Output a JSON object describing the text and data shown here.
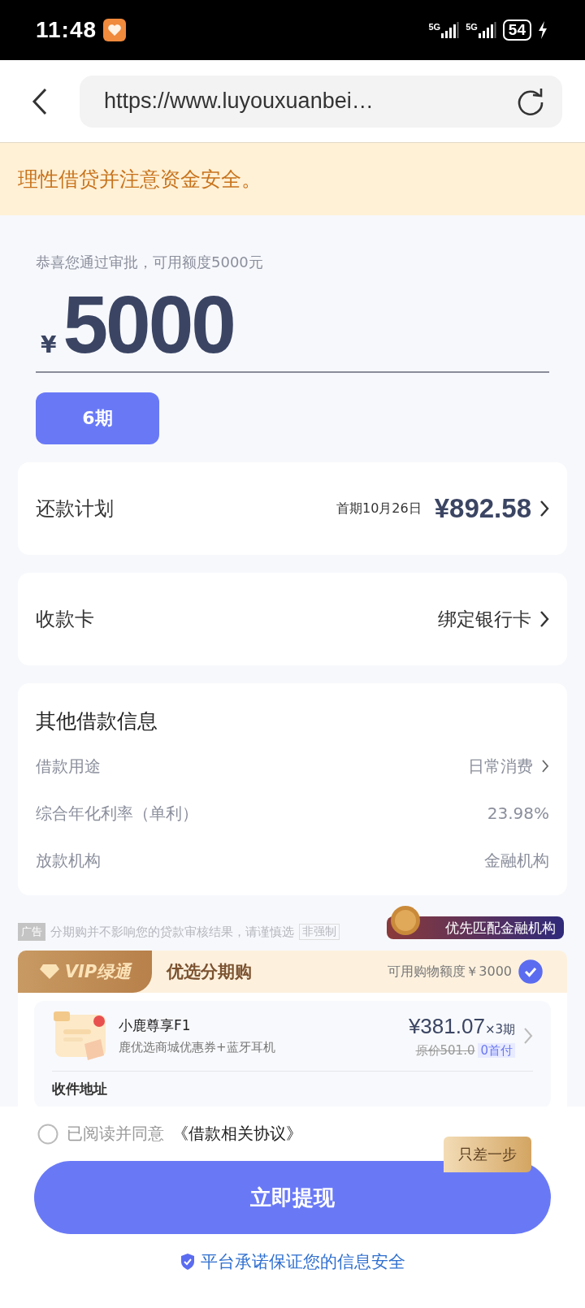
{
  "status_bar": {
    "time": "11:48",
    "networks": [
      "5G",
      "5G"
    ],
    "battery": "54"
  },
  "browser": {
    "url": "https://www.luyouxuanbei…"
  },
  "notice": {
    "text": "理性借贷并注意资金安全。"
  },
  "approval": {
    "hint": "恭喜您通过审批，可用额度5000元",
    "currency": "¥",
    "amount": "5000",
    "terms": [
      {
        "label": "6期",
        "selected": true
      }
    ]
  },
  "repayment": {
    "label": "还款计划",
    "first_date": "首期10月26日",
    "amount": "¥892.58"
  },
  "card": {
    "label": "收款卡",
    "value": "绑定银行卡"
  },
  "other_info": {
    "title": "其他借款信息",
    "rows": [
      {
        "label": "借款用途",
        "value": "日常消费",
        "has_arrow": true
      },
      {
        "label": "综合年化利率（单利）",
        "value": "23.98%",
        "has_arrow": false
      },
      {
        "label": "放款机构",
        "value": "金融机构",
        "has_arrow": false
      }
    ]
  },
  "ad": {
    "tag": "广告",
    "text": "分期购并不影响您的贷款审核结果，请谨慎选",
    "badge": "非强制",
    "promo": "优先匹配金融机构"
  },
  "vip": {
    "logo": "VIP绿通",
    "title": "优选分期购",
    "quota": "可用购物额度￥3000",
    "checked": true
  },
  "product": {
    "name": "小鹿尊享F1",
    "desc": "鹿优选商城优惠券+蓝牙耳机",
    "price": "¥381.07",
    "times": "×3期",
    "original_price": "原价501.0",
    "tag": "0首付",
    "address_label": "收件地址"
  },
  "agreement": {
    "checked": false,
    "text": "已阅读并同意",
    "link": "《借款相关协议》"
  },
  "submit": {
    "label": "立即提现",
    "tip": "只差一步"
  },
  "security": {
    "text": "平台承诺保证您的信息安全"
  }
}
